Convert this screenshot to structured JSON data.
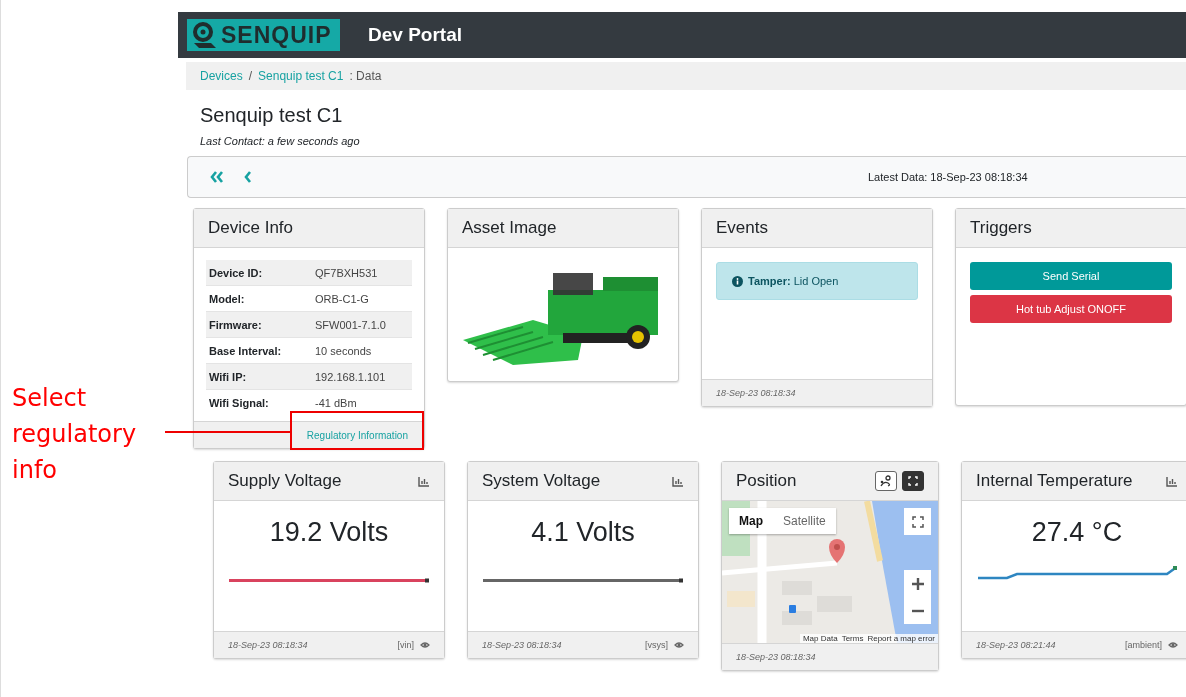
{
  "header": {
    "logo": "SENQUIP",
    "title": "Dev Portal"
  },
  "breadcrumb": [
    {
      "label": "Devices",
      "kind": "link"
    },
    {
      "label": "/",
      "kind": "separator"
    },
    {
      "label": "Senquip test C1",
      "kind": "link"
    },
    {
      "label": ": Data",
      "kind": "text"
    }
  ],
  "device": {
    "name": "Senquip test C1",
    "last_contact": "Last Contact: a few seconds ago"
  },
  "toolbar": {
    "latest_data": "Latest Data: 18-Sep-23 08:18:34"
  },
  "device_info": {
    "title": "Device Info",
    "rows": [
      {
        "label": "Device ID:",
        "value": "QF7BXH531"
      },
      {
        "label": "Model:",
        "value": "ORB-C1-G"
      },
      {
        "label": "Firmware:",
        "value": "SFW001-7.1.0"
      },
      {
        "label": "Base Interval:",
        "value": "10 seconds"
      },
      {
        "label": "Wifi IP:",
        "value": "192.168.1.101"
      },
      {
        "label": "Wifi Signal:",
        "value": "-41 dBm"
      }
    ],
    "link": "Regulatory Information"
  },
  "asset_image": {
    "title": "Asset Image"
  },
  "events": {
    "title": "Events",
    "alerts": [
      {
        "label": "Tamper:",
        "text": "Lid Open"
      }
    ],
    "timestamp": "18-Sep-23 08:18:34"
  },
  "triggers": {
    "title": "Triggers",
    "buttons": [
      {
        "label": "Send Serial",
        "color": "#009999"
      },
      {
        "label": "Hot tub Adjust ONOFF",
        "color": "#dc3545"
      }
    ]
  },
  "widgets": [
    {
      "kind": "value",
      "title": "Supply Voltage",
      "value": "19.2 Volts",
      "stepped": false,
      "color": "#d9435e",
      "timestamp": "18-Sep-23 08:18:34",
      "tag": "[vin]"
    },
    {
      "kind": "value",
      "title": "System Voltage",
      "value": "4.1 Volts",
      "stepped": false,
      "color": "#666666",
      "timestamp": "18-Sep-23 08:18:34",
      "tag": "[vsys]"
    },
    {
      "kind": "map",
      "title": "Position",
      "map_types": [
        {
          "label": "Map",
          "selected": true
        },
        {
          "label": "Satellite",
          "selected": false
        }
      ],
      "attribution": [
        "Map Data",
        "Terms",
        "Report a map error"
      ],
      "timestamp": "18-Sep-23 08:18:34"
    },
    {
      "kind": "value",
      "title": "Internal Temperature",
      "value": "27.4 °C",
      "stepped": true,
      "color": "#2e86c1",
      "timestamp": "18-Sep-23 08:21:44",
      "tag": "[ambient]"
    }
  ],
  "annotation": {
    "text": "Select regulatory info"
  }
}
